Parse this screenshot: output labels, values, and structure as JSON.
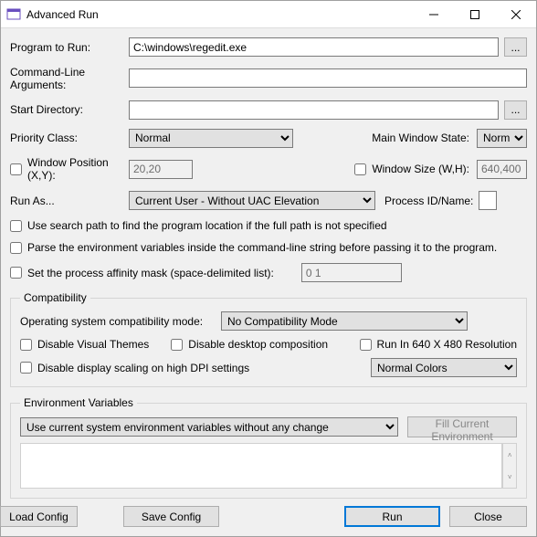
{
  "window_title": "Advanced Run",
  "labels": {
    "program": "Program to Run:",
    "args": "Command-Line Arguments:",
    "startdir": "Start Directory:",
    "priority": "Priority Class:",
    "mainwin": "Main Window State:",
    "winpos": "Window Position (X,Y):",
    "winsize": "Window Size (W,H):",
    "runas": "Run As...",
    "pidname": "Process ID/Name:",
    "searchpath": "Use search path to find the program location if the full path is not specified",
    "parseenv": "Parse the environment variables inside the command-line string before passing it to the program.",
    "affinity": "Set the process affinity mask (space-delimited list):",
    "compat_legend": "Compatibility",
    "compat_mode": "Operating system compatibility mode:",
    "dvt": "Disable Visual Themes",
    "ddc": "Disable desktop composition",
    "r640": "Run In 640 X 480 Resolution",
    "ddpi": "Disable display scaling on high DPI settings",
    "env_legend": "Environment Variables",
    "fillenv": "Fill Current Environment",
    "load": "Load Config",
    "save": "Save Config",
    "run": "Run",
    "close": "Close",
    "dots": "..."
  },
  "values": {
    "program": "C:\\windows\\regedit.exe",
    "args": "",
    "startdir": "",
    "priority": "Normal",
    "mainwin": "Normal",
    "winpos": "20,20",
    "winsize": "640,400",
    "runas": "Current User - Without UAC Elevation",
    "pidname": "",
    "affinity": "0 1",
    "compat_mode": "No Compatibility Mode",
    "colors": "Normal Colors",
    "envmode": "Use current system environment variables without any change"
  }
}
